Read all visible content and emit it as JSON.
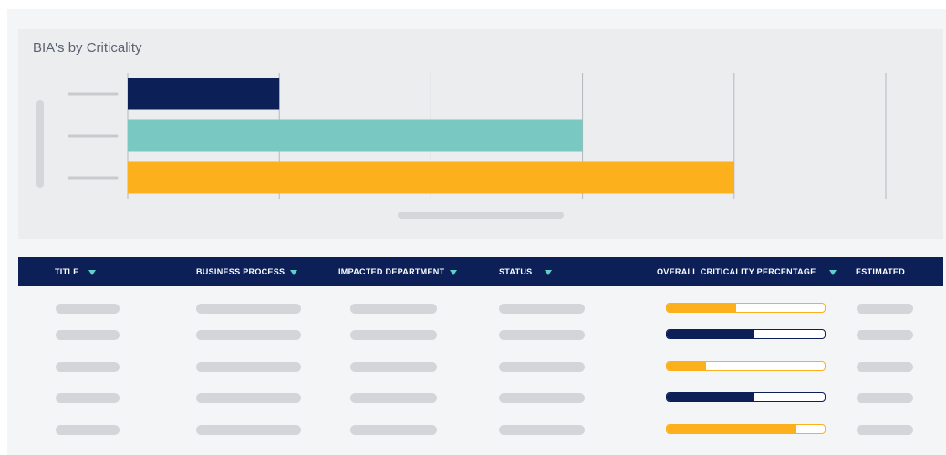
{
  "chart": {
    "title": "BIA's by Criticality"
  },
  "chart_data": {
    "type": "bar",
    "orientation": "horizontal",
    "title": "BIA's by Criticality",
    "categories": [
      "",
      "",
      ""
    ],
    "values": [
      1,
      3,
      4
    ],
    "colors": [
      "#0c1f57",
      "#79c9c2",
      "#fbb01c"
    ],
    "xlim": [
      0,
      5
    ],
    "grid": true
  },
  "table": {
    "headers": {
      "title": "TITLE",
      "business_process": "BUSINESS PROCESS",
      "impacted_department": "IMPACTED DEPARTMENT",
      "status": "STATUS",
      "criticality": "OVERALL CRITICALITY PERCENTAGE",
      "estimated": "ESTIMATED"
    },
    "rows": [
      {
        "criticality_fraction": 0.44,
        "bar_color": "#fbb01c",
        "border_color": "#fbb01c"
      },
      {
        "criticality_fraction": 0.55,
        "bar_color": "#0c1f57",
        "border_color": "#0c1f57"
      },
      {
        "criticality_fraction": 0.25,
        "bar_color": "#fbb01c",
        "border_color": "#fbb01c"
      },
      {
        "criticality_fraction": 0.55,
        "bar_color": "#0c1f57",
        "border_color": "#0c1f57"
      },
      {
        "criticality_fraction": 0.82,
        "bar_color": "#fbb01c",
        "border_color": "#fbb01c"
      }
    ]
  },
  "colors": {
    "navy": "#0c1f57",
    "teal": "#79c9c2",
    "amber": "#fbb01c",
    "sort_indicator": "#5fd0c6"
  },
  "icons": {
    "sort": "sort-down-triangle-icon"
  }
}
